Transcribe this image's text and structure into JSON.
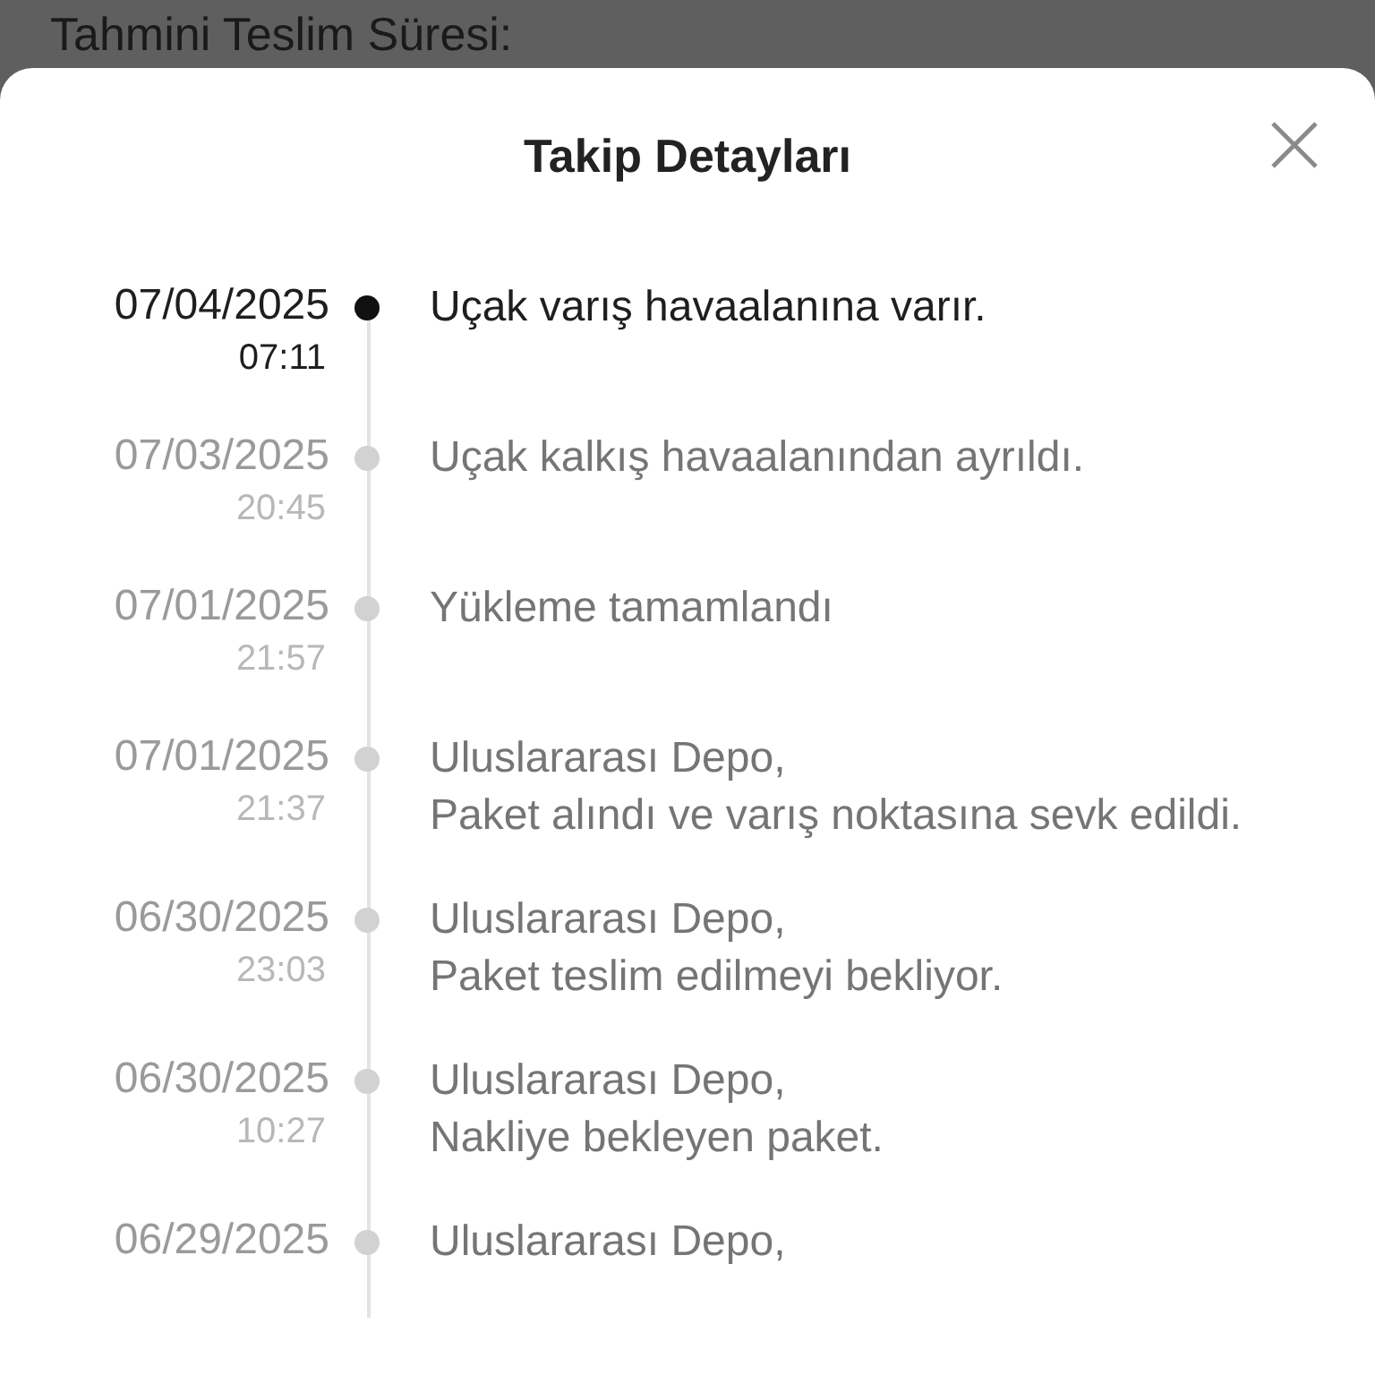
{
  "background": {
    "label": "Tahmini Teslim Süresi:"
  },
  "sheet": {
    "title": "Takip Detayları"
  },
  "events": [
    {
      "date": "07/04/2025",
      "time": "07:11",
      "lines": [
        "Uçak varış havaalanına varır."
      ],
      "current": true
    },
    {
      "date": "07/03/2025",
      "time": "20:45",
      "lines": [
        "Uçak kalkış havaalanından ayrıldı."
      ],
      "current": false
    },
    {
      "date": "07/01/2025",
      "time": "21:57",
      "lines": [
        "Yükleme tamamlandı"
      ],
      "current": false
    },
    {
      "date": "07/01/2025",
      "time": "21:37",
      "lines": [
        "Uluslararası Depo,",
        "Paket alındı ve varış noktasına sevk edildi."
      ],
      "current": false
    },
    {
      "date": "06/30/2025",
      "time": "23:03",
      "lines": [
        "Uluslararası Depo,",
        "Paket teslim edilmeyi bekliyor."
      ],
      "current": false
    },
    {
      "date": "06/30/2025",
      "time": "10:27",
      "lines": [
        "Uluslararası Depo,",
        "Nakliye bekleyen paket."
      ],
      "current": false
    },
    {
      "date": "06/29/2025",
      "lines": [
        "Uluslararası Depo,"
      ],
      "current": false
    }
  ]
}
